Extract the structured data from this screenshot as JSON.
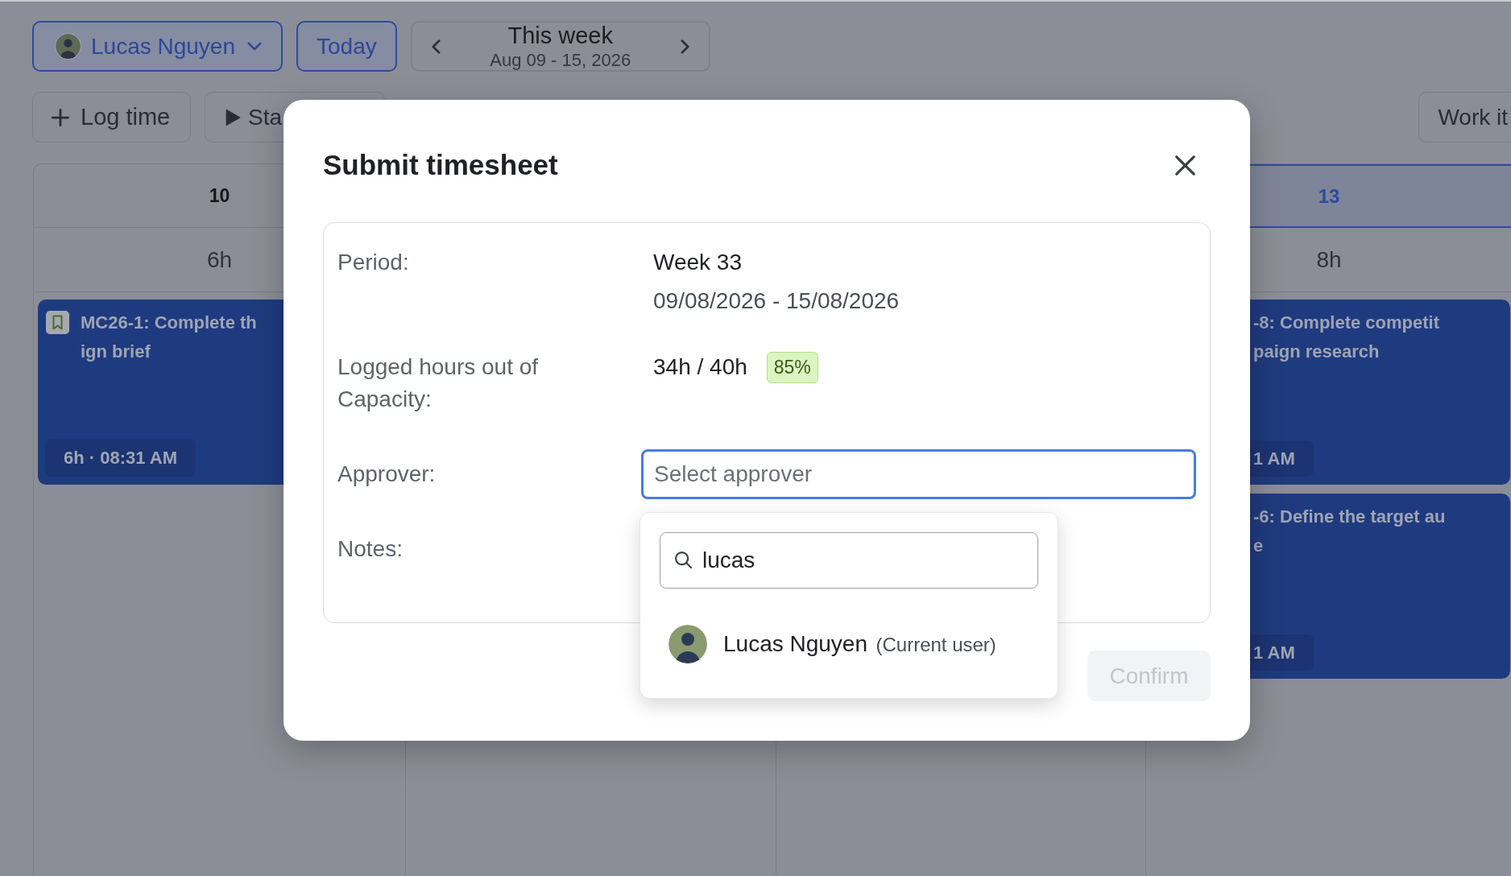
{
  "toolbar": {
    "user": {
      "name": "Lucas Nguyen"
    },
    "today": {
      "label": "Today"
    },
    "week": {
      "title": "This week",
      "range": "Aug 09 - 15, 2026"
    }
  },
  "actions": [
    {
      "kind": "add",
      "label": "Log time"
    },
    {
      "kind": "play",
      "label": "Sta"
    }
  ],
  "side_action": {
    "label": "Work it"
  },
  "calendar": {
    "columns": [
      {
        "day": "10",
        "today": false,
        "total": "6h",
        "entries": [
          {
            "bookmark": true,
            "title_lines": [
              "MC26-1: Complete th",
              "ign brief"
            ],
            "time": "6h · 08:31 AM"
          }
        ]
      },
      {
        "day": "13",
        "today": true,
        "total": "8h",
        "entries": [
          {
            "bookmark": false,
            "title_lines": [
              "-8: Complete competit",
              "paign research"
            ],
            "time": "1 AM"
          },
          {
            "bookmark": false,
            "title_lines": [
              "-6: Define the target au",
              "e"
            ],
            "time": "1 AM"
          }
        ]
      }
    ]
  },
  "dialog": {
    "title": "Submit timesheet",
    "rows": [
      {
        "kind": "period",
        "label": "Period:",
        "lines": [
          "Week 33",
          "09/08/2026 - 15/08/2026"
        ]
      },
      {
        "kind": "hours",
        "label": "Logged hours out of Capacity:",
        "value": "34h / 40h",
        "badge": "85%"
      },
      {
        "kind": "select",
        "label": "Approver:",
        "placeholder": "Select approver",
        "focused": true
      },
      {
        "kind": "notes",
        "label": "Notes:"
      }
    ],
    "approver_menu": {
      "search": {
        "value": "lucas"
      },
      "options": [
        {
          "name": "Lucas Nguyen",
          "note": "(Current user)",
          "selected": false
        }
      ]
    },
    "confirm": {
      "label": "Confirm",
      "disabled": true
    }
  }
}
